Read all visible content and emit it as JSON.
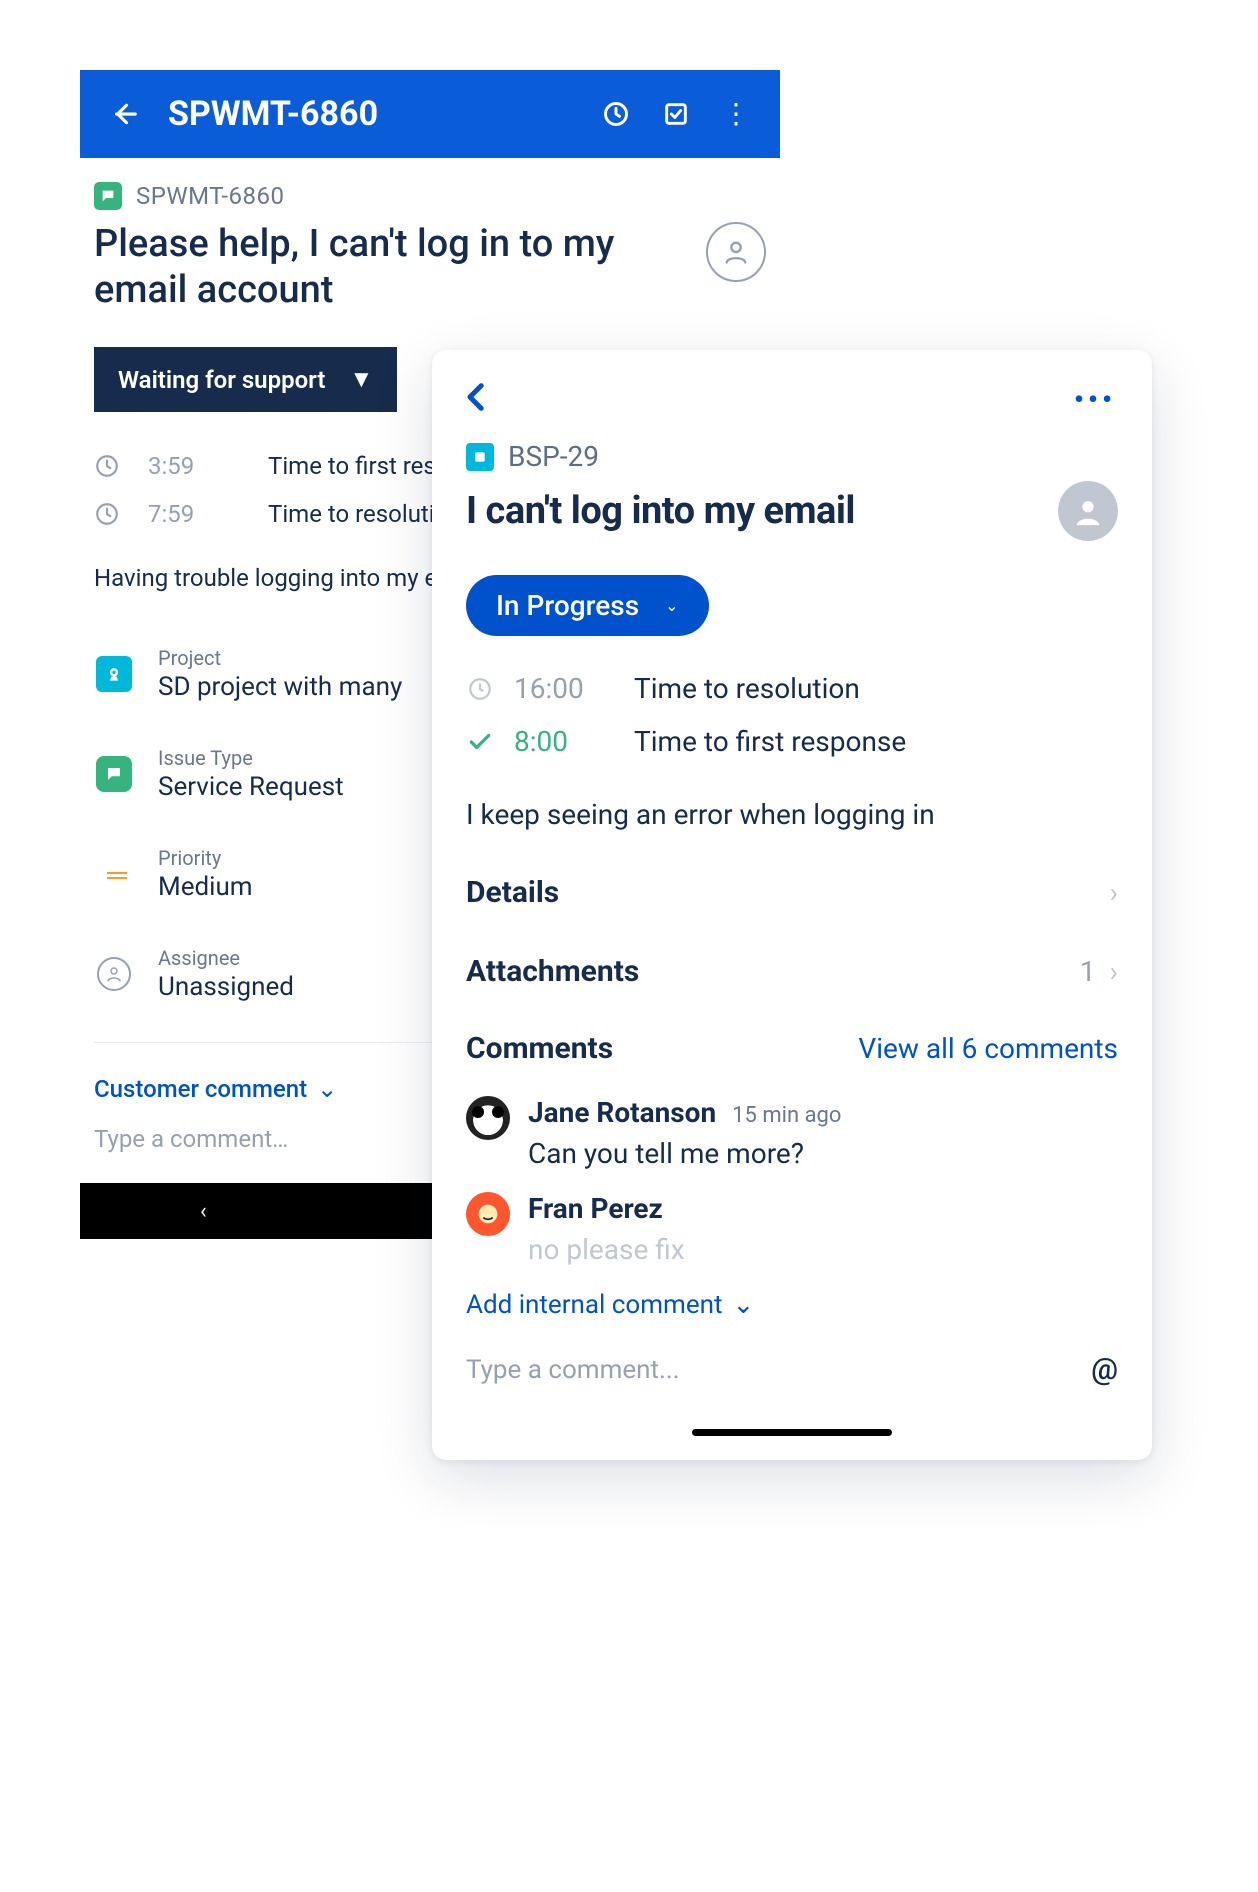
{
  "phoneA": {
    "appbar": {
      "title": "SPWMT-6860"
    },
    "key": "SPWMT-6860",
    "title": "Please help, I can't log in to my email account",
    "status": "Waiting for support",
    "sla": [
      {
        "time": "3:59",
        "label": "Time to first resp"
      },
      {
        "time": "7:59",
        "label": "Time to resolutio"
      }
    ],
    "description": "Having trouble logging into my e",
    "fields": {
      "project": {
        "label": "Project",
        "value": "SD project with many"
      },
      "issueType": {
        "label": "Issue Type",
        "value": "Service Request"
      },
      "priority": {
        "label": "Priority",
        "value": "Medium"
      },
      "assignee": {
        "label": "Assignee",
        "value": "Unassigned"
      }
    },
    "commentSelector": "Customer comment",
    "commentPlaceholder": "Type a comment…"
  },
  "phoneB": {
    "key": "BSP-29",
    "title": "I can't log into my email",
    "status": "In Progress",
    "sla": [
      {
        "state": "pending",
        "time": "16:00",
        "label": "Time to resolution"
      },
      {
        "state": "done",
        "time": "8:00",
        "label": "Time to first response"
      }
    ],
    "description": "I keep seeing an error when logging in",
    "sections": {
      "details": "Details",
      "attachments": {
        "label": "Attachments",
        "count": "1"
      }
    },
    "comments": {
      "header": "Comments",
      "viewAll": "View all 6 comments",
      "items": [
        {
          "author": "Jane Rotanson",
          "ago": "15 min ago",
          "body": "Can you tell me more?"
        },
        {
          "author": "Fran Perez",
          "ago": "",
          "body": "no please fix"
        }
      ]
    },
    "addComment": "Add internal comment",
    "commentPlaceholder": "Type a comment..."
  }
}
